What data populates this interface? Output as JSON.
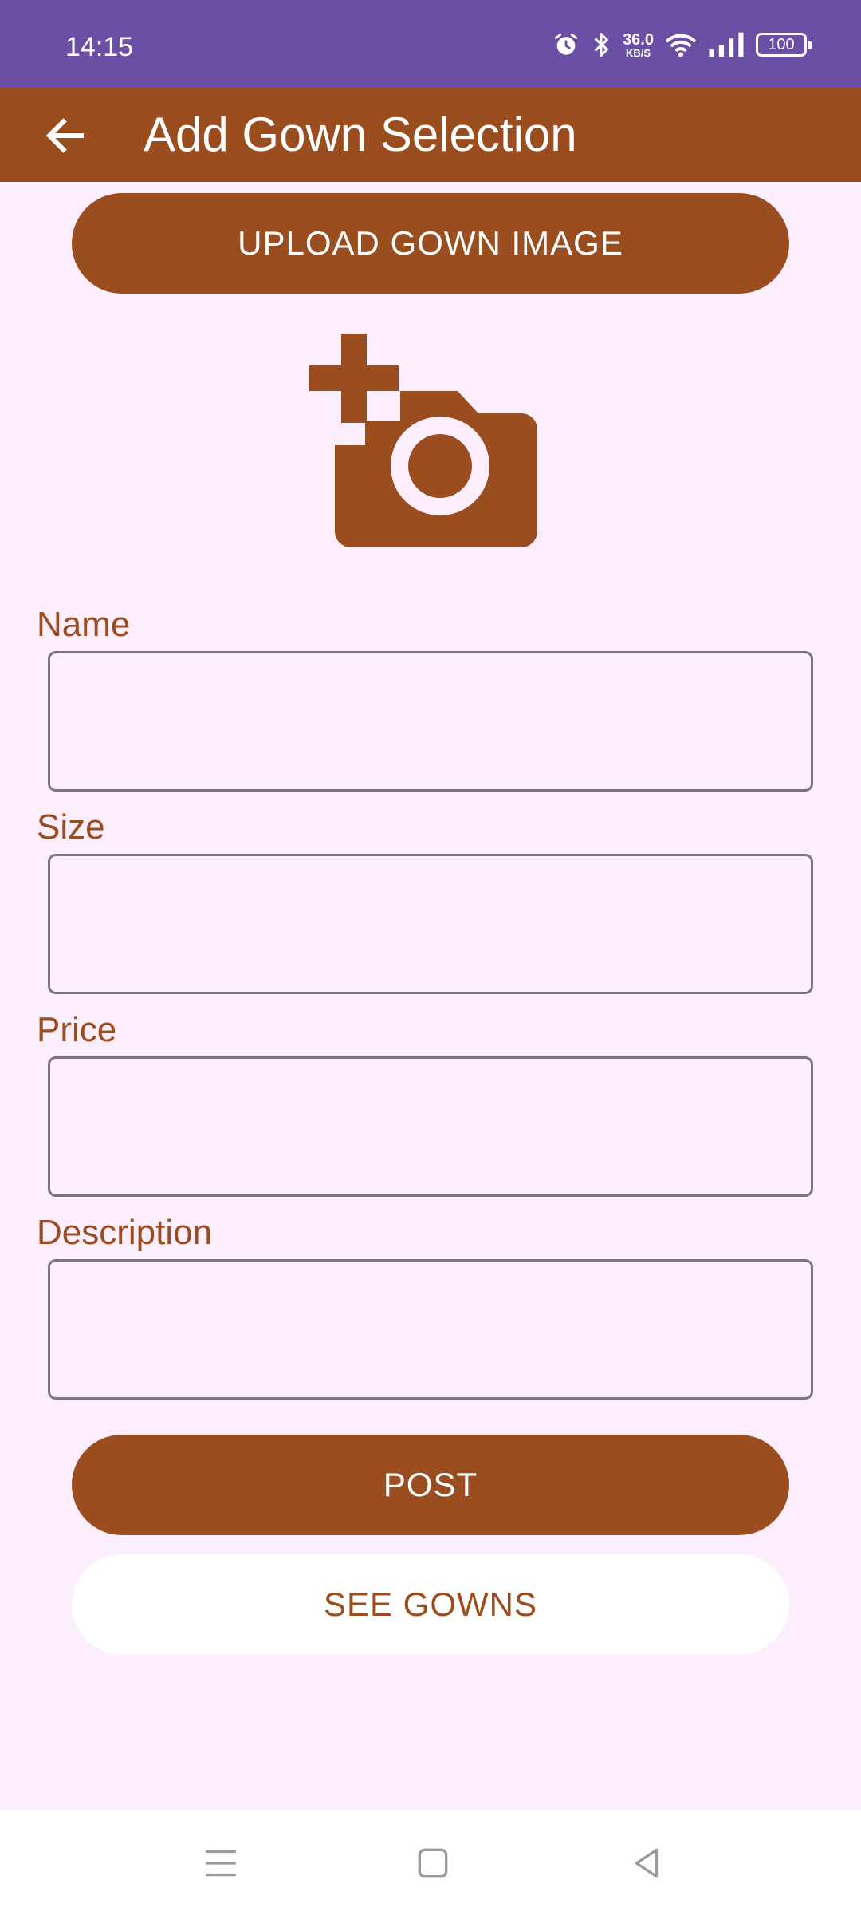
{
  "status_bar": {
    "time": "14:15",
    "network_speed_value": "36.0",
    "network_speed_unit": "KB/S",
    "battery": "100",
    "icons": [
      "alarm-icon",
      "bluetooth-icon",
      "wifi-icon",
      "signal-icon",
      "battery-icon"
    ]
  },
  "app_bar": {
    "title": "Add Gown Selection",
    "back_icon": "arrow-left-icon"
  },
  "upload_button": {
    "label": "UPLOAD GOWN IMAGE"
  },
  "image_placeholder": {
    "icon": "add-a-photo-icon"
  },
  "form": {
    "fields": [
      {
        "label": "Name",
        "value": ""
      },
      {
        "label": "Size",
        "value": ""
      },
      {
        "label": "Price",
        "value": ""
      },
      {
        "label": "Description",
        "value": ""
      }
    ]
  },
  "post_button": {
    "label": "POST"
  },
  "see_gowns_button": {
    "label": "SEE GOWNS"
  },
  "nav_bar": {
    "icons": [
      "menu-icon",
      "home-icon",
      "back-icon"
    ]
  },
  "colors": {
    "status_bar": "#6a4fa5",
    "accent": "#9a4d1f",
    "background": "#fdeefd",
    "field_border": "#7e7385"
  }
}
